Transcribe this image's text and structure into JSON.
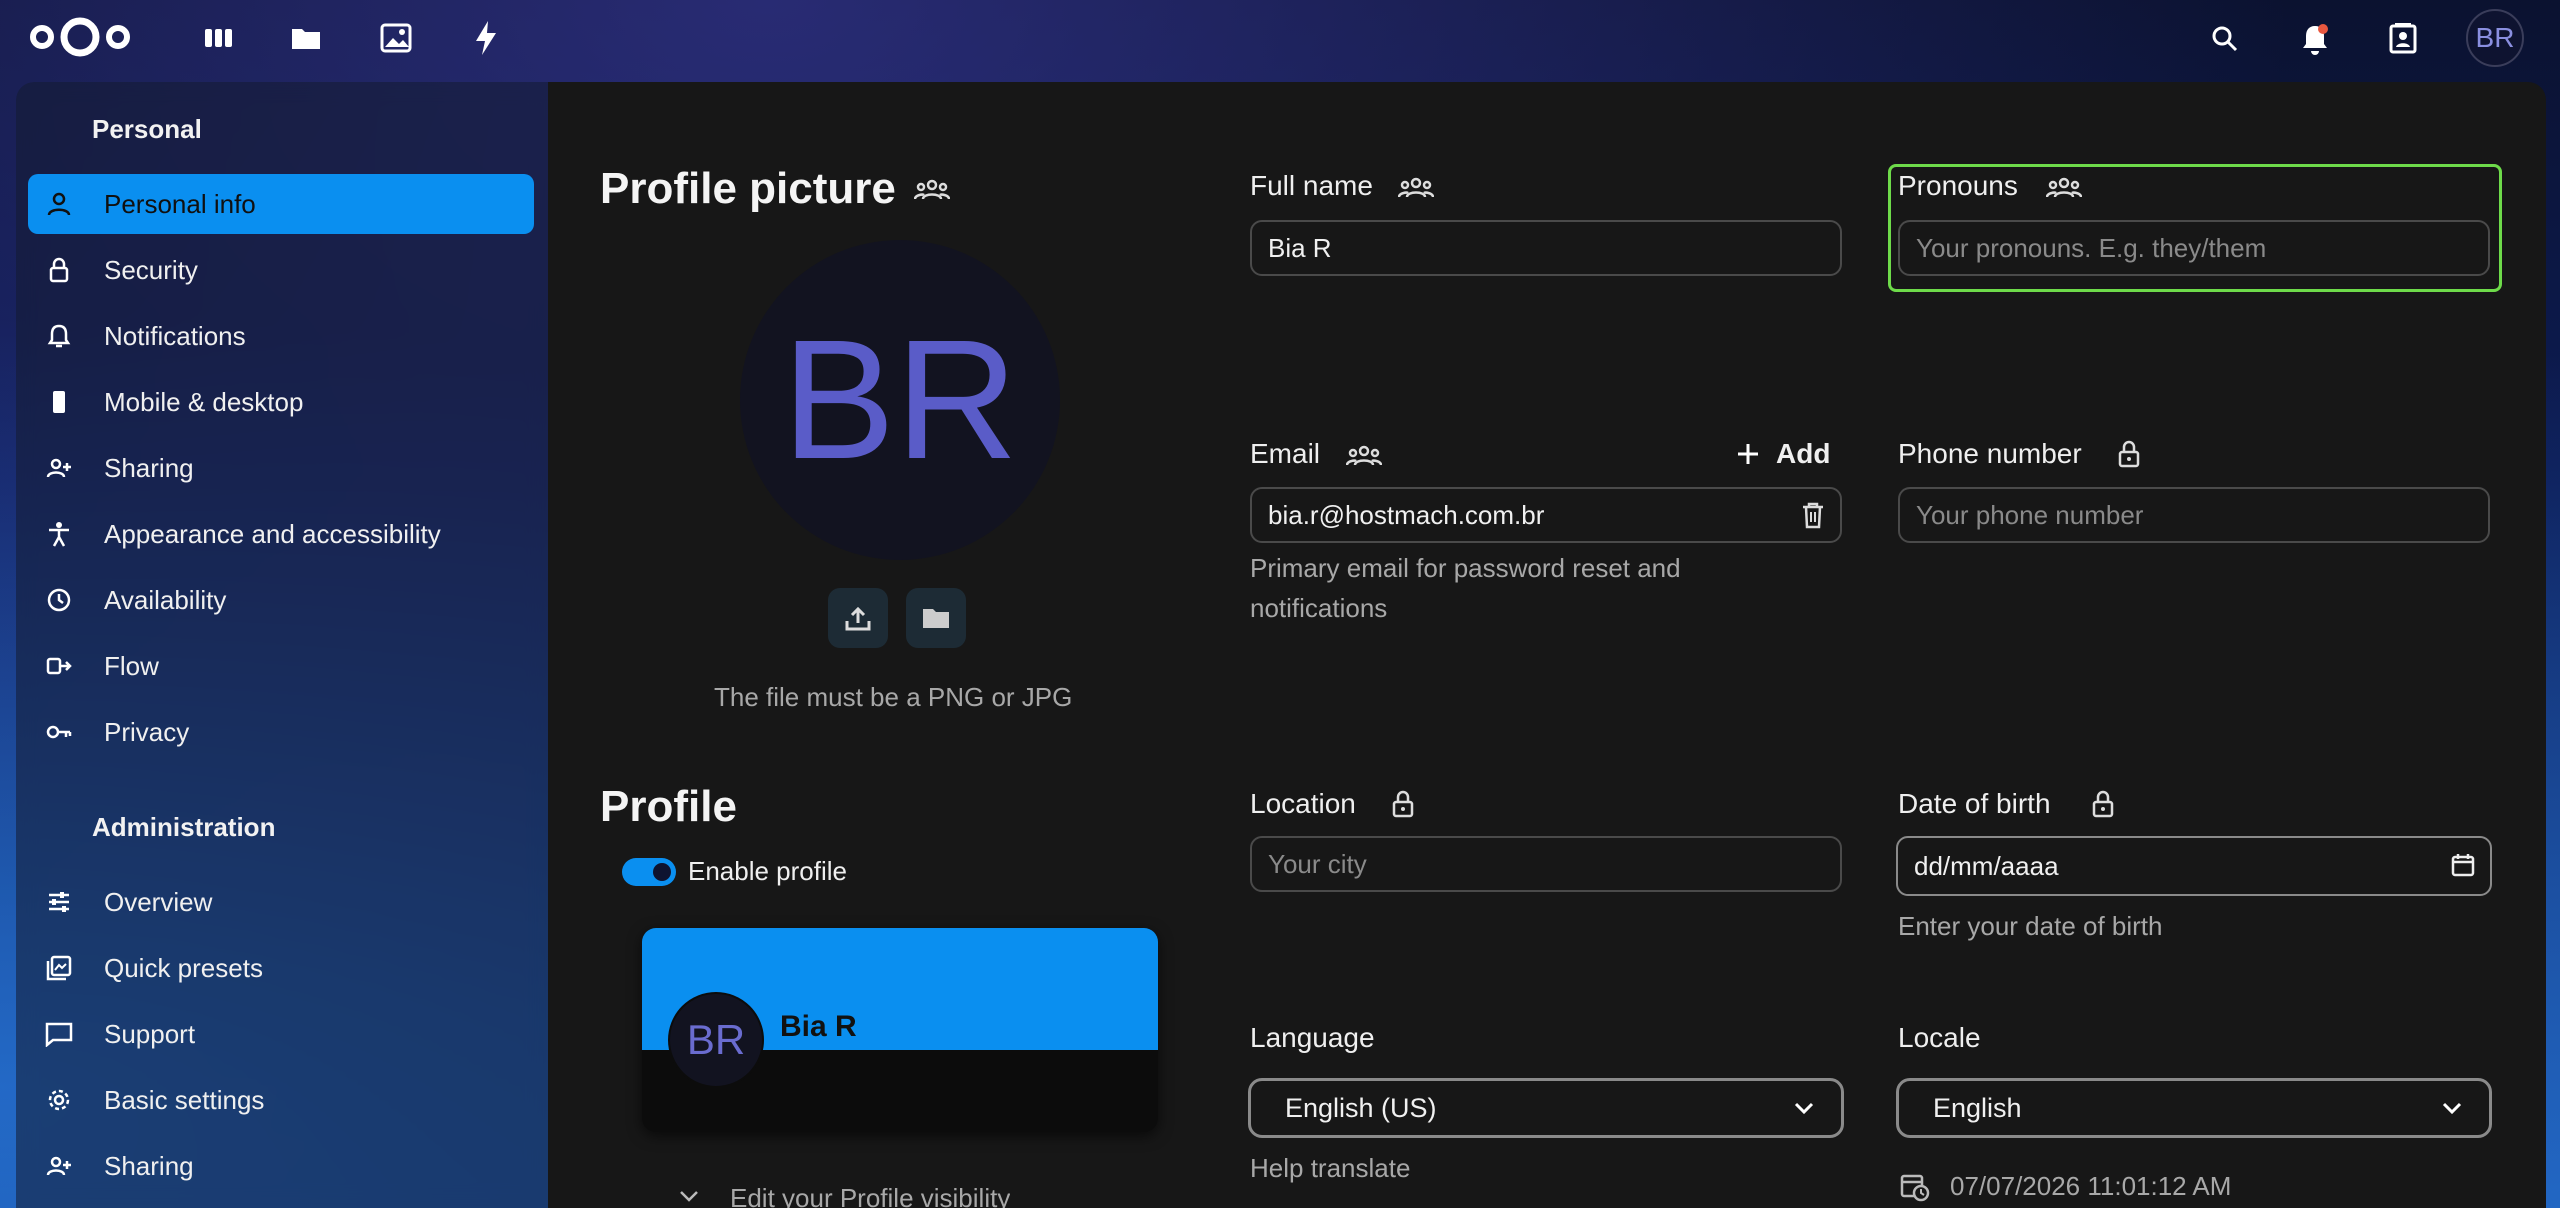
{
  "header": {
    "avatar_initials": "BR",
    "apps": [
      "dashboard-icon",
      "files-icon",
      "photos-icon",
      "activity-icon"
    ],
    "right_icons": [
      "search-icon",
      "notifications-icon",
      "contacts-icon"
    ]
  },
  "sidebar": {
    "personal_title": "Personal",
    "personal_items": [
      {
        "label": "Personal info",
        "icon": "user-icon"
      },
      {
        "label": "Security",
        "icon": "lock-icon"
      },
      {
        "label": "Notifications",
        "icon": "bell-icon"
      },
      {
        "label": "Mobile & desktop",
        "icon": "phone-icon"
      },
      {
        "label": "Sharing",
        "icon": "share-icon"
      },
      {
        "label": "Appearance and accessibility",
        "icon": "accessibility-icon"
      },
      {
        "label": "Availability",
        "icon": "clock-icon"
      },
      {
        "label": "Flow",
        "icon": "flow-icon"
      },
      {
        "label": "Privacy",
        "icon": "key-icon"
      }
    ],
    "admin_title": "Administration",
    "admin_items": [
      {
        "label": "Overview",
        "icon": "sliders-icon"
      },
      {
        "label": "Quick presets",
        "icon": "presets-icon"
      },
      {
        "label": "Support",
        "icon": "support-icon"
      },
      {
        "label": "Basic settings",
        "icon": "gear-icon"
      },
      {
        "label": "Sharing",
        "icon": "share-icon"
      }
    ]
  },
  "profile_picture": {
    "title": "Profile picture",
    "initials": "BR",
    "hint": "The file must be a PNG or JPG"
  },
  "profile": {
    "title": "Profile",
    "enable_label": "Enable profile",
    "enabled": true,
    "card_initials": "BR",
    "card_name": "Bia R",
    "edit_visibility": "Edit your Profile visibility"
  },
  "fields": {
    "full_name": {
      "label": "Full name",
      "value": "Bia R"
    },
    "pronouns": {
      "label": "Pronouns",
      "placeholder": "Your pronouns. E.g. they/them"
    },
    "email": {
      "label": "Email",
      "add_label": "Add",
      "value": "bia.r@hostmach.com.br",
      "hint_line1": "Primary email for password reset and",
      "hint_line2": "notifications"
    },
    "phone": {
      "label": "Phone number",
      "placeholder": "Your phone number"
    },
    "location": {
      "label": "Location",
      "placeholder": "Your city"
    },
    "birth": {
      "label": "Date of birth",
      "value": "dd/mm/aaaa",
      "hint": "Enter your date of birth"
    },
    "language": {
      "label": "Language",
      "value": "English (US)",
      "help": "Help translate"
    },
    "locale": {
      "label": "Locale",
      "value": "English",
      "time": "07/07/2026 11:01:12 AM"
    }
  },
  "colors": {
    "accent": "#0a8ff0",
    "focus": "#6edb4a",
    "avatar_text": "#5a5cc8"
  }
}
